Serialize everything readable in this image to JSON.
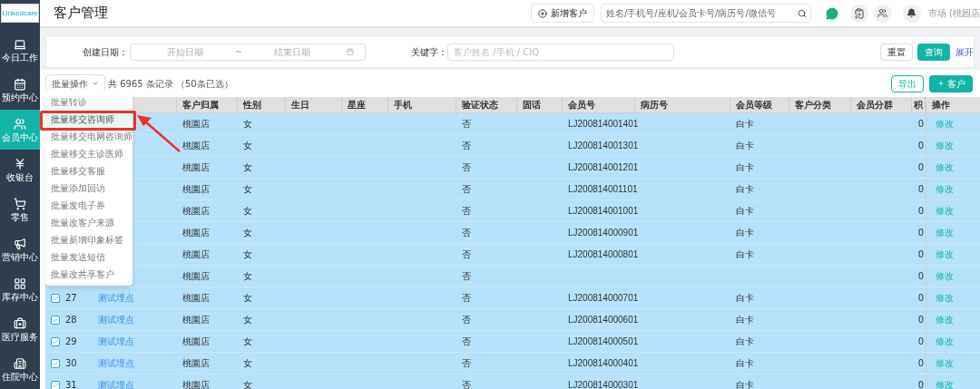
{
  "logo": {
    "text": "Linkedcare"
  },
  "sidebar": {
    "items": [
      {
        "label": "今日工作",
        "selected": false
      },
      {
        "label": "预约中心",
        "selected": false
      },
      {
        "label": "会员中心",
        "selected": true
      },
      {
        "label": "收银台",
        "selected": false
      },
      {
        "label": "零售",
        "selected": false
      },
      {
        "label": "营销中心",
        "selected": false
      },
      {
        "label": "库存中心",
        "selected": false
      },
      {
        "label": "医疗服务",
        "selected": false
      },
      {
        "label": "住院中心",
        "selected": false
      }
    ]
  },
  "header": {
    "title": "客户管理",
    "new_customer_button": "新增客户",
    "search": {
      "placeholder": "姓名/手机号/座机/会员卡号/病历号/微信号"
    },
    "user": "市场 (桃园店"
  },
  "filter": {
    "date_label": "创建日期：",
    "start_placeholder": "开始日期",
    "separator": "~",
    "end_placeholder": "结束日期",
    "keyword_label": "关键字：",
    "keyword_placeholder": "客户姓名 /手机 / CIQ",
    "reset_button": "重置",
    "query_button": "查询",
    "expand_link": "展开"
  },
  "toolbar": {
    "batch_button": "批量操作",
    "summary": "共 6965 条记录 （50条已选）",
    "export_button": "导出",
    "add_button": "客户"
  },
  "batch_menu": {
    "items": [
      {
        "label": "批量转诊",
        "selected": false
      },
      {
        "label": "批量移交咨询师",
        "selected": true
      },
      {
        "label": "批量移交电网咨询师",
        "selected": false
      },
      {
        "label": "批量移交主诊医师",
        "selected": false
      },
      {
        "label": "批量移交客服",
        "selected": false
      },
      {
        "label": "批量添加回访",
        "selected": false
      },
      {
        "label": "批量发电子券",
        "selected": false
      },
      {
        "label": "批量改客户来源",
        "selected": false
      },
      {
        "label": "批量新增印象标签",
        "selected": false
      },
      {
        "label": "批量发送短信",
        "selected": false
      },
      {
        "label": "批量改共享客户",
        "selected": false
      }
    ]
  },
  "table": {
    "columns": [
      "客户归属",
      "性别",
      "生日",
      "星座",
      "手机",
      "验证状态",
      "固话",
      "会员号",
      "病历号",
      "会员等级",
      "客户分类",
      "会员分群",
      "积",
      "操作"
    ],
    "rows": [
      {
        "store": "桃園店",
        "gender": "女",
        "verified": "否",
        "member_no": "LJ200814001401",
        "level": "白卡",
        "points": "0",
        "action": "修改"
      },
      {
        "store": "桃園店",
        "gender": "女",
        "verified": "否",
        "member_no": "LJ200814001301",
        "level": "白卡",
        "points": "0",
        "action": "修改"
      },
      {
        "store": "桃園店",
        "gender": "女",
        "verified": "否",
        "member_no": "LJ200814001201",
        "level": "白卡",
        "points": "0",
        "action": "修改"
      },
      {
        "store": "桃園店",
        "gender": "女",
        "verified": "否",
        "member_no": "LJ200814001101",
        "level": "白卡",
        "points": "0",
        "action": "修改"
      },
      {
        "store": "桃園店",
        "gender": "女",
        "verified": "否",
        "member_no": "LJ200814001001",
        "level": "白卡",
        "points": "0",
        "action": "修改"
      },
      {
        "store": "桃園店",
        "gender": "女",
        "verified": "否",
        "member_no": "LJ200814000901",
        "level": "白卡",
        "points": "0",
        "action": "修改"
      },
      {
        "store": "桃園店",
        "gender": "女",
        "verified": "否",
        "member_no": "LJ200814000801",
        "level": "白卡",
        "points": "0",
        "action": "修改"
      },
      {
        "store": "桃園店",
        "gender": "女",
        "verified": "否",
        "points": "0",
        "action": "修改"
      },
      {
        "checked": true,
        "index": "27",
        "name": "测试埋点",
        "store": "桃園店",
        "gender": "女",
        "verified": "否",
        "member_no": "LJ200814000701",
        "level": "白卡",
        "points": "0",
        "action": "修改"
      },
      {
        "checked": true,
        "index": "28",
        "name": "测试埋点",
        "store": "桃園店",
        "gender": "女",
        "verified": "否",
        "member_no": "LJ200814000601",
        "level": "白卡",
        "points": "0",
        "action": "修改"
      },
      {
        "checked": true,
        "index": "29",
        "name": "测试埋点",
        "store": "桃園店",
        "gender": "女",
        "verified": "否",
        "member_no": "LJ200814000501",
        "level": "白卡",
        "points": "0",
        "action": "修改"
      },
      {
        "checked": true,
        "index": "30",
        "name": "测试埋点",
        "store": "桃園店",
        "gender": "女",
        "verified": "否",
        "member_no": "LJ200814000401",
        "level": "白卡",
        "points": "0",
        "action": "修改"
      },
      {
        "checked": true,
        "index": "31",
        "name": "测试埋点",
        "store": "桃園店",
        "gender": "女",
        "verified": "否",
        "member_no": "LJ200814000301",
        "level": "白卡",
        "points": "0",
        "action": "修改"
      }
    ]
  }
}
